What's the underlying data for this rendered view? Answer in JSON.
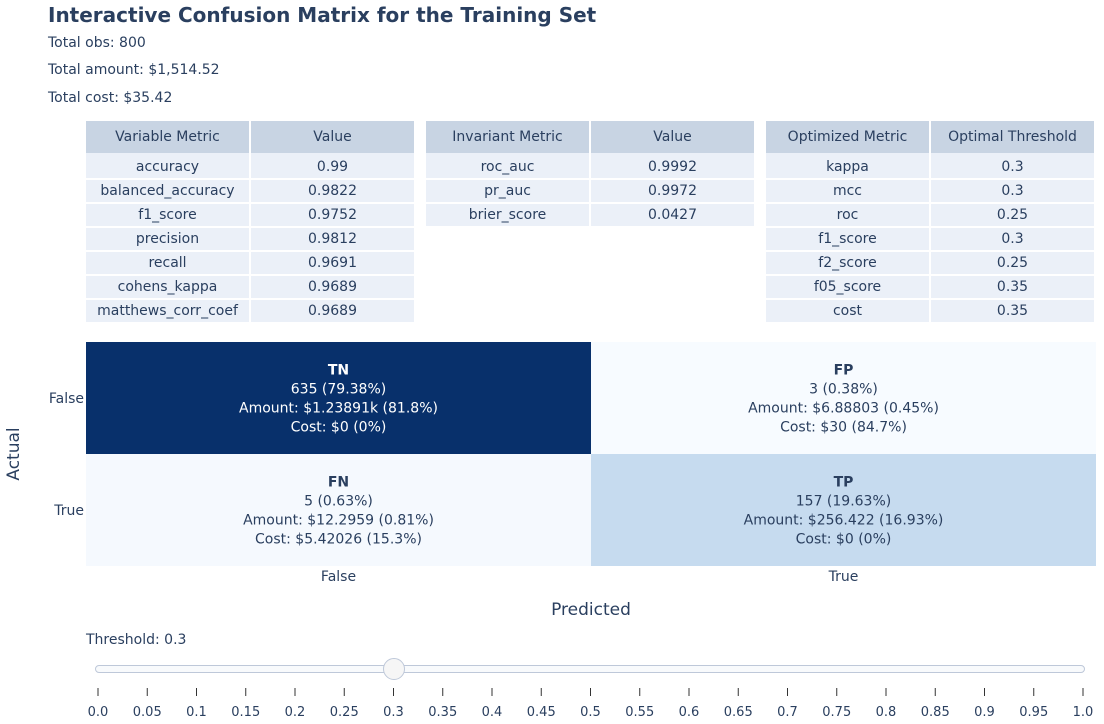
{
  "title": "Interactive Confusion Matrix for the Training Set",
  "summary": {
    "total_obs": "Total obs: 800",
    "total_amount": "Total amount: $1,514.52",
    "total_cost": "Total cost: $35.42"
  },
  "tables": {
    "variable": {
      "headers": [
        "Variable Metric",
        "Value"
      ],
      "rows": [
        [
          "accuracy",
          "0.99"
        ],
        [
          "balanced_accuracy",
          "0.9822"
        ],
        [
          "f1_score",
          "0.9752"
        ],
        [
          "precision",
          "0.9812"
        ],
        [
          "recall",
          "0.9691"
        ],
        [
          "cohens_kappa",
          "0.9689"
        ],
        [
          "matthews_corr_coef",
          "0.9689"
        ]
      ]
    },
    "invariant": {
      "headers": [
        "Invariant Metric",
        "Value"
      ],
      "rows": [
        [
          "roc_auc",
          "0.9992"
        ],
        [
          "pr_auc",
          "0.9972"
        ],
        [
          "brier_score",
          "0.0427"
        ]
      ]
    },
    "optimized": {
      "headers": [
        "Optimized Metric",
        "Optimal Threshold"
      ],
      "rows": [
        [
          "kappa",
          "0.3"
        ],
        [
          "mcc",
          "0.3"
        ],
        [
          "roc",
          "0.25"
        ],
        [
          "f1_score",
          "0.3"
        ],
        [
          "f2_score",
          "0.25"
        ],
        [
          "f05_score",
          "0.35"
        ],
        [
          "cost",
          "0.35"
        ]
      ]
    }
  },
  "chart_data": {
    "type": "heatmap",
    "xlabel": "Predicted",
    "ylabel": "Actual",
    "x_categories": [
      "False",
      "True"
    ],
    "y_categories": [
      "False",
      "True"
    ],
    "cells": [
      {
        "actual": "False",
        "predicted": "False",
        "label": "TN",
        "count": 635,
        "lines": [
          "635 (79.38%)",
          "Amount: $1.23891k (81.8%)",
          "Cost: $0 (0%)"
        ],
        "color": "#08306b",
        "text_color": "#ffffff"
      },
      {
        "actual": "False",
        "predicted": "True",
        "label": "FP",
        "count": 3,
        "lines": [
          "3 (0.38%)",
          "Amount: $6.88803 (0.45%)",
          "Cost: $30 (84.7%)"
        ],
        "color": "#f7fbff",
        "text_color": "#2a3f5f"
      },
      {
        "actual": "True",
        "predicted": "False",
        "label": "FN",
        "count": 5,
        "lines": [
          "5 (0.63%)",
          "Amount: $12.2959 (0.81%)",
          "Cost: $5.42026 (15.3%)"
        ],
        "color": "#f5f9fe",
        "text_color": "#2a3f5f"
      },
      {
        "actual": "True",
        "predicted": "True",
        "label": "TP",
        "count": 157,
        "lines": [
          "157 (19.63%)",
          "Amount: $256.422 (16.93%)",
          "Cost: $0 (0%)"
        ],
        "color": "#c6dbef",
        "text_color": "#2a3f5f"
      }
    ]
  },
  "slider": {
    "label": "Threshold: 0.3",
    "value": 0.3,
    "min": 0.0,
    "max": 1.0,
    "ticks": [
      "0.0",
      "0.05",
      "0.1",
      "0.15",
      "0.2",
      "0.25",
      "0.3",
      "0.35",
      "0.4",
      "0.45",
      "0.5",
      "0.55",
      "0.6",
      "0.65",
      "0.7",
      "0.75",
      "0.8",
      "0.85",
      "0.9",
      "0.95",
      "1.0"
    ]
  }
}
